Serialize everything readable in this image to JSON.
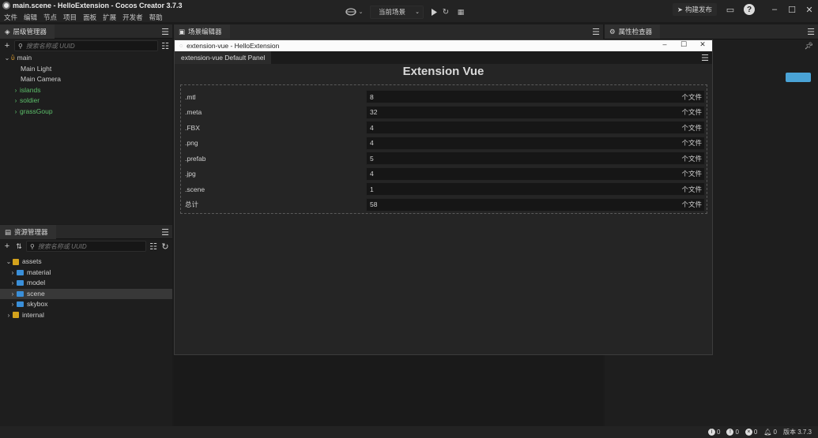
{
  "window": {
    "title": "main.scene - HelloExtension - Cocos Creator 3.7.3"
  },
  "menu": [
    "文件",
    "编辑",
    "节点",
    "项目",
    "面板",
    "扩展",
    "开发者",
    "帮助"
  ],
  "toolbar": {
    "scene_select": "当前场景",
    "build_label": "构建发布"
  },
  "hierarchy": {
    "tab": "层级管理器",
    "search_placeholder": "搜索名称或 UUID",
    "items": [
      {
        "label": "main"
      },
      {
        "label": "Main Light"
      },
      {
        "label": "Main Camera"
      },
      {
        "label": "islands"
      },
      {
        "label": "soldier"
      },
      {
        "label": "grassGoup"
      }
    ]
  },
  "scene_editor": {
    "tab": "场景编辑器"
  },
  "inspector": {
    "tab": "属性检查器"
  },
  "assets": {
    "tab": "资源管理器",
    "search_placeholder": "搜索名称或 UUID",
    "items": [
      {
        "label": "assets"
      },
      {
        "label": "material"
      },
      {
        "label": "model"
      },
      {
        "label": "scene"
      },
      {
        "label": "skybox"
      },
      {
        "label": "internal"
      }
    ]
  },
  "dialog": {
    "title": "extension-vue - HelloExtension",
    "tab": "extension-vue Default Panel",
    "heading": "Extension Vue",
    "unit": "个文件",
    "rows": [
      {
        "label": ".mtl",
        "value": "8"
      },
      {
        "label": ".meta",
        "value": "32"
      },
      {
        "label": ".FBX",
        "value": "4"
      },
      {
        "label": ".png",
        "value": "4"
      },
      {
        "label": ".prefab",
        "value": "5"
      },
      {
        "label": ".jpg",
        "value": "4"
      },
      {
        "label": ".scene",
        "value": "1"
      },
      {
        "label": "总计",
        "value": "58"
      }
    ]
  },
  "status": {
    "info": "0",
    "warn": "0",
    "error": "0",
    "notify": "0",
    "version": "版本 3.7.3"
  }
}
